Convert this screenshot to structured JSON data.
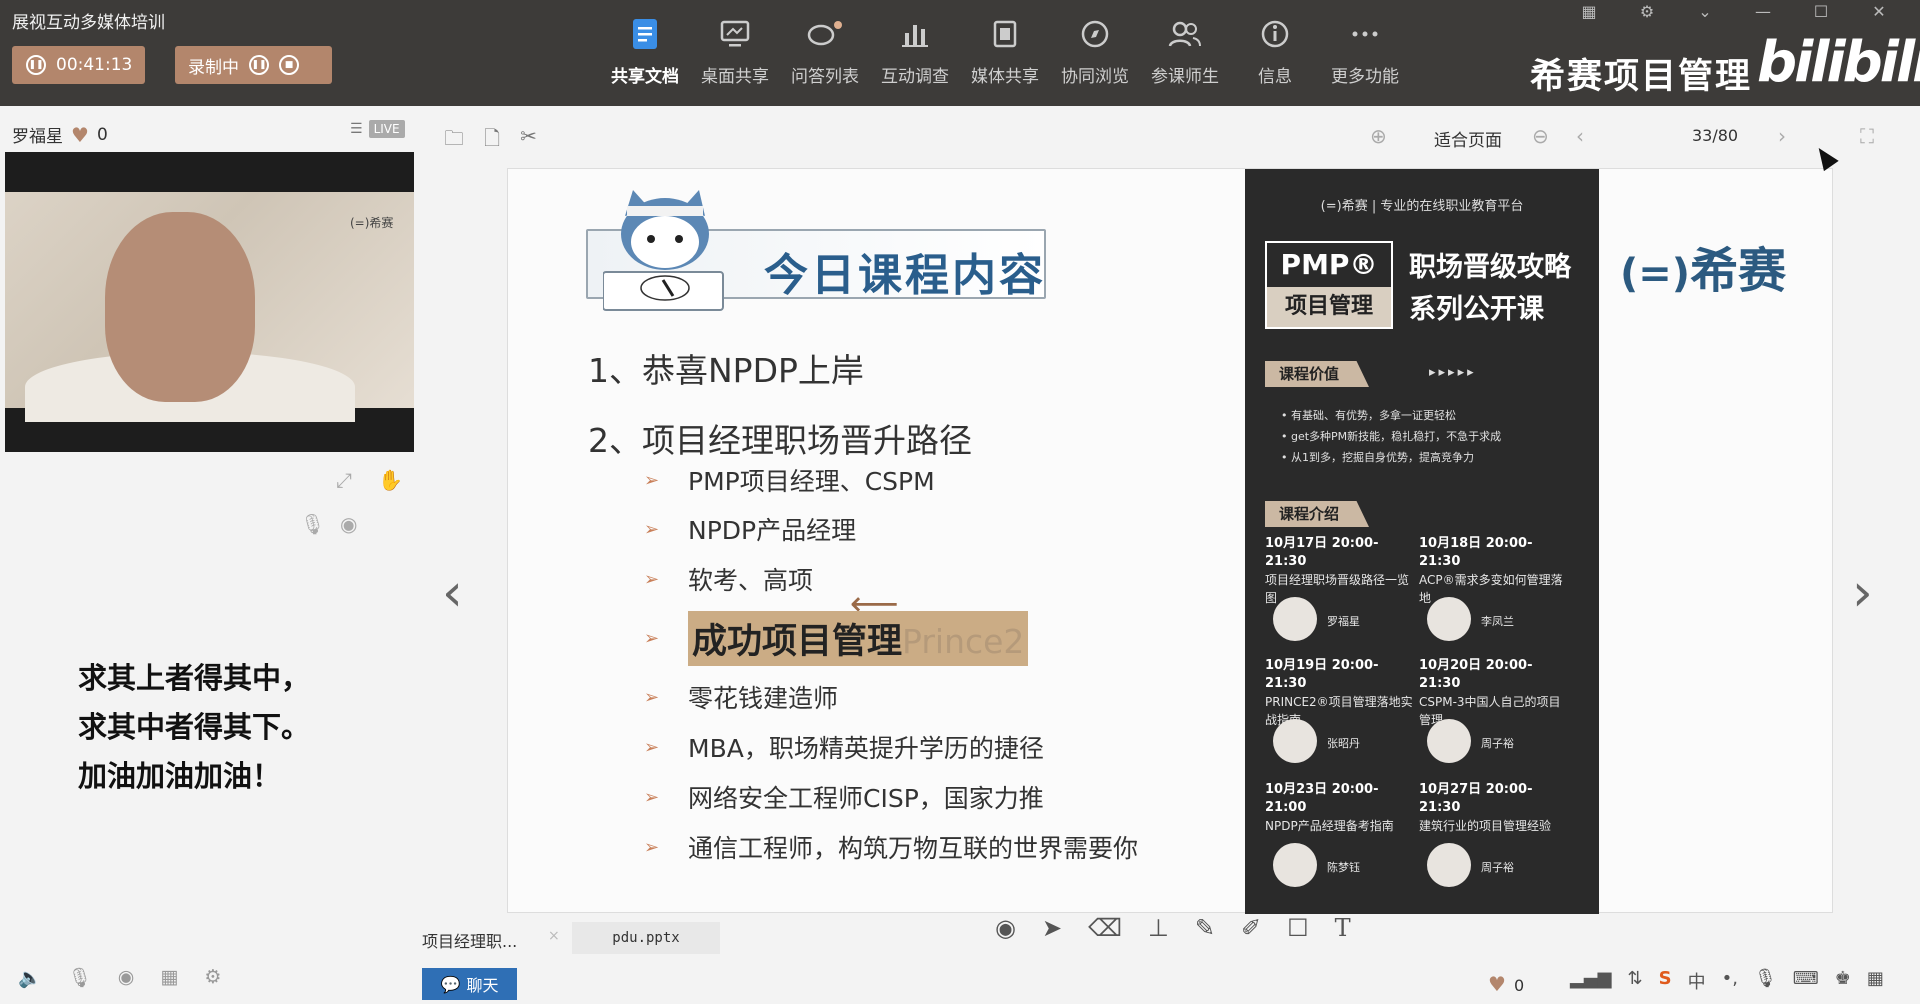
{
  "topbar": {
    "app_title": "展视互动多媒体培训",
    "timer": "00:41:13",
    "recording_label": "录制中",
    "tools": [
      {
        "label": "共享文档",
        "icon": "document-icon",
        "active": true
      },
      {
        "label": "桌面共享",
        "icon": "desktop-icon",
        "active": false
      },
      {
        "label": "问答列表",
        "icon": "qa-icon",
        "active": false
      },
      {
        "label": "互动调查",
        "icon": "chart-icon",
        "active": false
      },
      {
        "label": "媒体共享",
        "icon": "film-icon",
        "active": false
      },
      {
        "label": "协同浏览",
        "icon": "compass-icon",
        "active": false
      },
      {
        "label": "参课师生",
        "icon": "users-icon",
        "active": false
      },
      {
        "label": "信息",
        "icon": "info-icon",
        "active": false
      },
      {
        "label": "更多功能",
        "icon": "more-icon",
        "active": false
      }
    ],
    "brand": "希赛项目管理",
    "bili_logo": "bilibili"
  },
  "left_panel": {
    "speaker_name": "罗福星",
    "like_count": "0",
    "live_badge": "LIVE",
    "video_watermark": "(=)希赛",
    "motto_lines": [
      "求其上者得其中，",
      "求其中者得其下。",
      "加油加油加油！"
    ]
  },
  "doc_toolbar": {
    "zoom_mode": "适合页面",
    "page_indicator": "33/80"
  },
  "slide": {
    "title": "今日课程内容",
    "item1": "1、恭喜NPDP上岸",
    "item2": "2、项目经理职场晋升路径",
    "subitems": [
      "PMP项目经理、CSPM",
      "NPDP产品经理",
      "软考、高项",
      "成功项目管理",
      "零花钱建造师",
      "MBA，职场精英提升学历的捷径",
      "网络安全工程师CISP，国家力推",
      "通信工程师，构筑万物互联的世界需要你"
    ],
    "highlight_ghost": "Prince2",
    "logo_right": "希赛",
    "poster": {
      "top_line": "(=)希赛 | 专业的在线职业教育平台",
      "pmp": "PMP®",
      "pmp_sub": "项目管理",
      "title_line1": "职场晋级攻略",
      "title_line2": "系列公开课",
      "value_tag": "课程价值",
      "value_arrows": "▸▸▸▸▸",
      "bullets": [
        "• 有基础、有优势，多拿一证更轻松",
        "• get多种PM新技能，稳扎稳打，不急于求成",
        "• 从1到多，挖掘自身优势，提高竞争力"
      ],
      "intro_tag": "课程介绍",
      "sessions": [
        {
          "date": "10月17日 20:00-21:30",
          "topic": "项目经理职场晋级路径一览图",
          "teacher": "罗福星"
        },
        {
          "date": "10月18日 20:00-21:30",
          "topic": "ACP®需求多变如何管理落地",
          "teacher": "李凤兰"
        },
        {
          "date": "10月19日 20:00-21:30",
          "topic": "PRINCE2®项目管理落地实战指南",
          "teacher": "张昭丹"
        },
        {
          "date": "10月20日 20:00-21:30",
          "topic": "CSPM-3中国人自己的项目管理",
          "teacher": "周子裕"
        },
        {
          "date": "10月23日 20:00-21:00",
          "topic": "NPDP产品经理备考指南",
          "teacher": "陈梦钰"
        },
        {
          "date": "10月27日 20:00-21:30",
          "topic": "建筑行业的项目管理经验",
          "teacher": "周子裕"
        }
      ]
    }
  },
  "file_tabs": {
    "tab1": "项目经理职...",
    "tab2": "pdu.pptx"
  },
  "bottom": {
    "chat_label": "聊天",
    "like_count": "0"
  },
  "colors": {
    "accent": "#b3866c",
    "topbar_bg": "#3d3b39",
    "chat_blue": "#2f6fb5",
    "slide_title": "#2a5e8c"
  }
}
